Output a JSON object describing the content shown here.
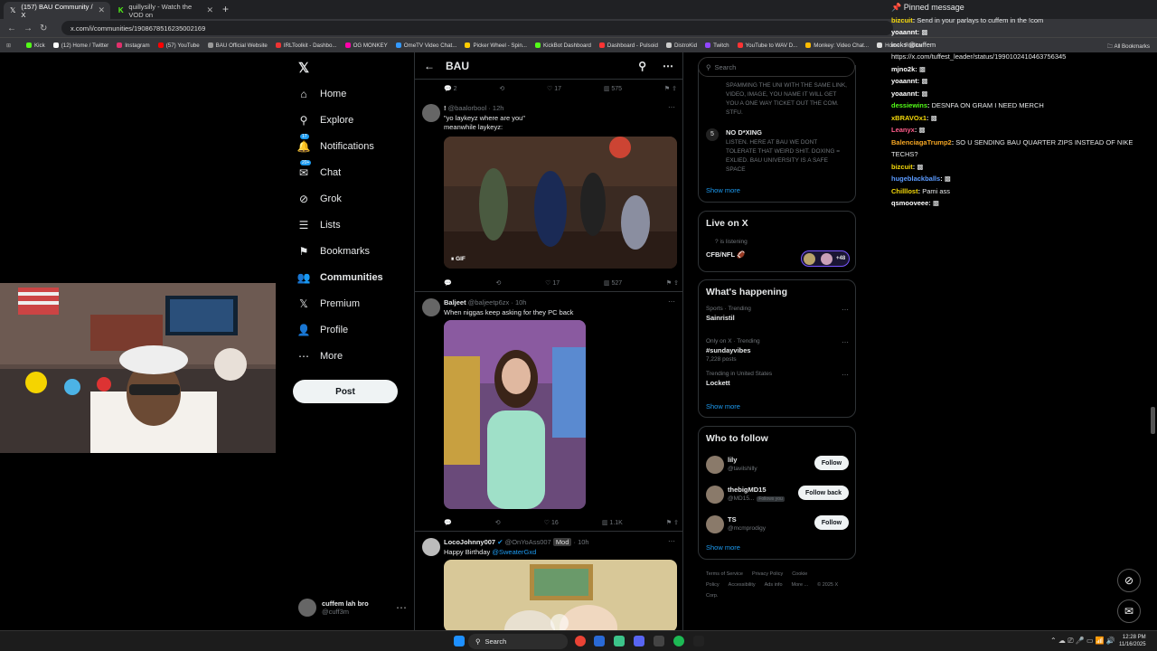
{
  "browser": {
    "tabs": [
      {
        "label": "(157) BAU Community / X",
        "icon": "x-logo-icon",
        "active": true
      },
      {
        "label": "quillysilly - Watch the VOD on",
        "icon": "kick-icon",
        "active": false
      }
    ],
    "url": "x.com/i/communities/1908678516235002169",
    "bookmarks": [
      {
        "label": "Kick",
        "color": "#53fc18"
      },
      {
        "label": "(12) Home / Twitter",
        "color": "#ffffff"
      },
      {
        "label": "Instagram",
        "color": "#e1306c"
      },
      {
        "label": "(57) YouTube",
        "color": "#ff0000"
      },
      {
        "label": "BAU Official Website",
        "color": "#999999"
      },
      {
        "label": "IRLToolkit - Dashbo...",
        "color": "#e33"
      },
      {
        "label": "OG MONKEY",
        "color": "#f0a"
      },
      {
        "label": "OmeTV Video Chat...",
        "color": "#39f"
      },
      {
        "label": "Picker Wheel - Spin...",
        "color": "#fc0"
      },
      {
        "label": "KickBot Dashboard",
        "color": "#53fc18"
      },
      {
        "label": "Dashboard - Pulsoid",
        "color": "#f33"
      },
      {
        "label": "DistroKid",
        "color": "#ccc"
      },
      {
        "label": "Twitch",
        "color": "#9146ff"
      },
      {
        "label": "YouTube to WAV D...",
        "color": "#f33"
      },
      {
        "label": "Monkey: Video Chat...",
        "color": "#fb0"
      },
      {
        "label": "Home - Roblox",
        "color": "#ddd"
      }
    ],
    "all_bookmarks": "All Bookmarks"
  },
  "nav": {
    "items": [
      {
        "label": "Home",
        "icon": "home-icon",
        "glyph": "⌂",
        "bold": false,
        "badge": ""
      },
      {
        "label": "Explore",
        "icon": "search-icon",
        "glyph": "⚲",
        "bold": false,
        "badge": ""
      },
      {
        "label": "Notifications",
        "icon": "bell-icon",
        "glyph": "🔔",
        "bold": false,
        "badge": "17"
      },
      {
        "label": "Chat",
        "icon": "chat-icon",
        "glyph": "✉",
        "bold": false,
        "badge": "20+"
      },
      {
        "label": "Grok",
        "icon": "grok-icon",
        "glyph": "⊘",
        "bold": false,
        "badge": ""
      },
      {
        "label": "Lists",
        "icon": "list-icon",
        "glyph": "☰",
        "bold": false,
        "badge": ""
      },
      {
        "label": "Bookmarks",
        "icon": "bookmark-icon",
        "glyph": "⚑",
        "bold": false,
        "badge": ""
      },
      {
        "label": "Communities",
        "icon": "communities-icon",
        "glyph": "👥",
        "bold": true,
        "badge": ""
      },
      {
        "label": "Premium",
        "icon": "premium-x-icon",
        "glyph": "𝕏",
        "bold": false,
        "badge": ""
      },
      {
        "label": "Profile",
        "icon": "profile-icon",
        "glyph": "👤",
        "bold": false,
        "badge": ""
      },
      {
        "label": "More",
        "icon": "more-icon",
        "glyph": "⋯",
        "bold": false,
        "badge": ""
      }
    ],
    "post": "Post",
    "account": {
      "name": "cuffem lah bro",
      "handle": "@cuff3m"
    }
  },
  "feed": {
    "title": "BAU",
    "top_stats": {
      "replies": "2",
      "likes": "17",
      "views": "575"
    },
    "tweets": [
      {
        "name": "!",
        "handle": "@baalorbool",
        "time": "12h",
        "text": "\"yo laykeyz where are you\"",
        "text2": "meanwhile laykeyz:",
        "media": "GIF",
        "replies": "",
        "likes": "17",
        "views": "527"
      },
      {
        "name": "Baljeet",
        "handle": "@baljeetp6zx",
        "time": "10h",
        "text": "When niggas keep asking for they PC back",
        "text2": "",
        "replies": "",
        "likes": "16",
        "views": "1.1K"
      },
      {
        "name": "LocoJohnny007",
        "handle": "@OnYoAss007",
        "badge": "Mod",
        "time": "10h",
        "text": "Happy Birthday",
        "mention": "@SweaterGxd"
      }
    ]
  },
  "right": {
    "search": "Search",
    "rules": {
      "text4": "SPAMMING THE UNI WITH THE SAME LINK, VIDEO, IMAGE, YOU NAME IT WILL GET YOU A ONE WAY TICKET OUT THE COM. STFU.",
      "num5": "5",
      "title5": "NO D*XING",
      "text5": "LISTEN. HERE AT BAU WE DONT TOLERATE THAT WEIRD SHIT. DOXING = EXLIED. BAU UNIVERSITY IS A SAFE SPACE",
      "show_more": "Show more"
    },
    "live": {
      "title": "Live on X",
      "listening": "is listening",
      "space": "CFB/NFL 🏈",
      "count": "+48"
    },
    "happening": {
      "title": "What's happening",
      "items": [
        {
          "context": "Sports · Trending",
          "topic": "Sainristil",
          "posts": ""
        },
        {
          "context": "Only on X · Trending",
          "topic": "#sundayvibes",
          "posts": "7,228 posts"
        },
        {
          "context": "Trending in United States",
          "topic": "Lockett",
          "posts": ""
        }
      ],
      "show_more": "Show more"
    },
    "who": {
      "title": "Who to follow",
      "users": [
        {
          "name": "lily",
          "handle": "@tavilshilly",
          "btn": "Follow",
          "follows_you": ""
        },
        {
          "name": "thebigMD15",
          "handle": "@MD15...",
          "btn": "Follow back",
          "follows_you": "Follows you"
        },
        {
          "name": "TS",
          "handle": "@mcmprodigy",
          "btn": "Follow",
          "follows_you": ""
        }
      ],
      "show_more": "Show more"
    },
    "footer": [
      "Terms of Service",
      "Privacy Policy",
      "Cookie Policy",
      "Accessibility",
      "Ads info",
      "More ...",
      "© 2025 X Corp."
    ]
  },
  "chat": {
    "pinned_title": "Pinned message",
    "pinned_user": "bizcuit",
    "pinned_text": "Send in your parlays to cuffem in the !com",
    "messages": [
      {
        "user": "yoaannt",
        "color": "#ffffff",
        "text": "▩"
      },
      {
        "user": "",
        "color": "#ffffff",
        "text": "locks @cuffem"
      },
      {
        "user": "",
        "color": "#ffffff",
        "text": "https://x.com/tuffest_leader/status/1990102410463756345"
      },
      {
        "user": "mjno2k",
        "color": "#ffffff",
        "text": "▩"
      },
      {
        "user": "yoaannt",
        "color": "#ffffff",
        "text": "▩"
      },
      {
        "user": "yoaannt",
        "color": "#ffffff",
        "text": "▩"
      },
      {
        "user": "dessiewins",
        "color": "#53fc18",
        "text": "DESNFA ON GRAM I NEED MERCH"
      },
      {
        "user": "xBRAVOx1",
        "color": "#f5d90a",
        "text": "▩"
      },
      {
        "user": "Leanyx",
        "color": "#ff5c8a",
        "text": "▩"
      },
      {
        "user": "BalenciagaTrump2",
        "color": "#f5a623",
        "text": "SO U SENDING BAU QUARTER ZIPS INSTEAD OF NIKE TECHS?"
      },
      {
        "user": "bizcuit",
        "color": "#f5d90a",
        "text": "▩"
      },
      {
        "user": "hugeblackballs",
        "color": "#5b9bff",
        "text": "▩"
      },
      {
        "user": "Chilllost",
        "color": "#f5d90a",
        "text": "Pami ass"
      },
      {
        "user": "qsmooveee",
        "color": "#ffffff",
        "text": "▩"
      }
    ]
  },
  "taskbar": {
    "search": "Search",
    "time": "12:28 PM",
    "date": "11/16/2025"
  }
}
